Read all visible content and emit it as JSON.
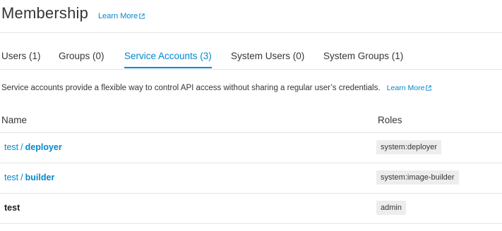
{
  "header": {
    "title": "Membership",
    "learn_more": "Learn More"
  },
  "tabs": [
    {
      "label": "Users (1)",
      "active": false
    },
    {
      "label": "Groups (0)",
      "active": false
    },
    {
      "label": "Service Accounts (3)",
      "active": true
    },
    {
      "label": "System Users (0)",
      "active": false
    },
    {
      "label": "System Groups (1)",
      "active": false
    }
  ],
  "description": {
    "text": "Service accounts provide a flexible way to control API access without sharing a regular user’s credentials.",
    "learn_more": "Learn More"
  },
  "table": {
    "headers": {
      "name": "Name",
      "roles": "Roles"
    },
    "rows": [
      {
        "namespace": "test",
        "separator": "/",
        "account": "deployer",
        "role": "system:deployer"
      },
      {
        "namespace": "test",
        "separator": "/",
        "account": "builder",
        "role": "system:image-builder"
      },
      {
        "name": "test",
        "role": "admin"
      }
    ]
  },
  "colors": {
    "link": "#0088ce",
    "text": "#363636",
    "badge_bg": "#ededed",
    "divider": "#e5e5e5"
  },
  "icons": {
    "external_link": "external-link-icon"
  }
}
